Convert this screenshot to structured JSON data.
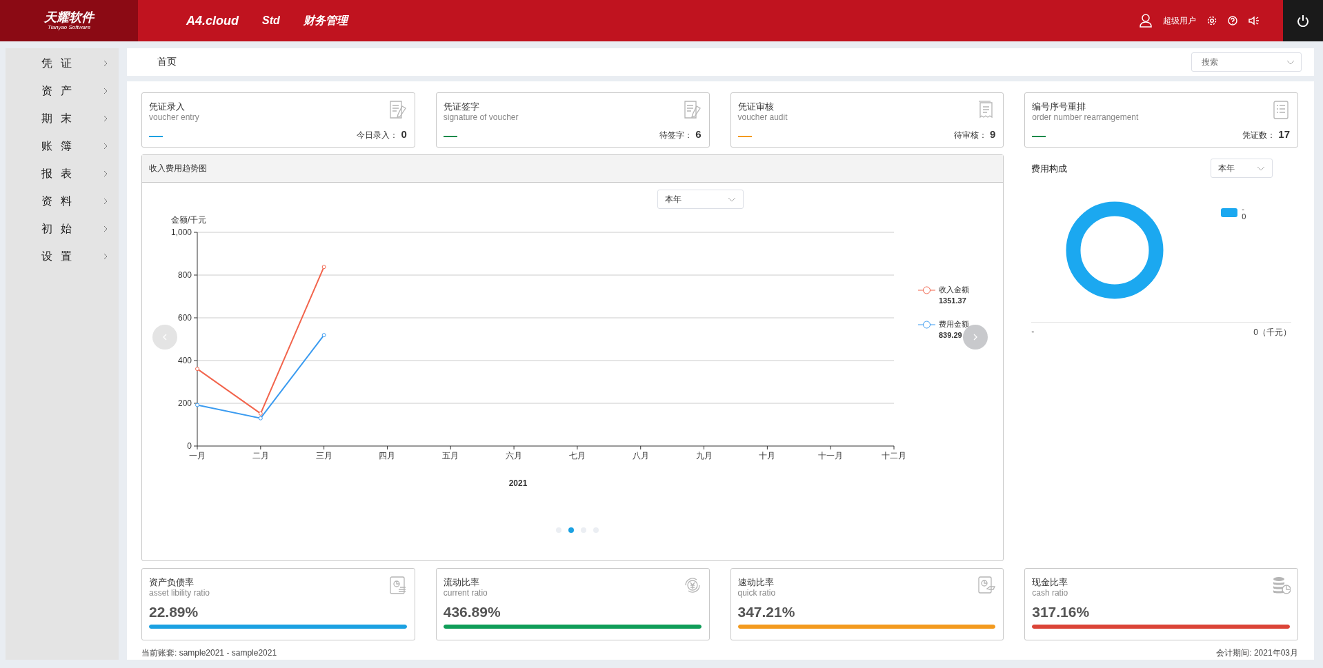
{
  "header": {
    "logo": "天耀软件",
    "logo_sub": "Tianyao Software",
    "nav": [
      "A4.cloud",
      "Std",
      "财务管理"
    ],
    "user": "超级用户"
  },
  "sidebar": {
    "items": [
      {
        "label": "凭证"
      },
      {
        "label": "资产"
      },
      {
        "label": "期末"
      },
      {
        "label": "账簿"
      },
      {
        "label": "报表"
      },
      {
        "label": "资料"
      },
      {
        "label": "初始"
      },
      {
        "label": "设置"
      }
    ]
  },
  "breadcrumb": "首页",
  "search": {
    "placeholder": "搜索"
  },
  "task_cards": [
    {
      "title": "凭证录入",
      "subtitle": "voucher entry",
      "color": "#1ba1e2",
      "count_label": "今日录入：",
      "count": "0",
      "kind": "edit"
    },
    {
      "title": "凭证签字",
      "subtitle": "signature of voucher",
      "color": "#0f8a4a",
      "count_label": "待签字：",
      "count": "6",
      "kind": "edit"
    },
    {
      "title": "凭证审核",
      "subtitle": "voucher audit",
      "color": "#f39a1e",
      "count_label": "待审核：",
      "count": "9",
      "kind": "receipt"
    },
    {
      "title": "编号序号重排",
      "subtitle": "order number rearrangement",
      "color": "#0f8a4a",
      "count_label": "凭证数：",
      "count": "17",
      "kind": "list"
    }
  ],
  "trend": {
    "title": "收入费用趋势图",
    "period": "本年",
    "legend_totals": [
      "1351.37",
      "839.29"
    ],
    "chart_data": {
      "type": "line",
      "grid": true,
      "legend": true,
      "xlabel": "2021",
      "ylabel": "金额/千元",
      "categories": [
        "一月",
        "二月",
        "三月",
        "四月",
        "五月",
        "六月",
        "七月",
        "八月",
        "九月",
        "十月",
        "十一月",
        "十二月"
      ],
      "ylim": [
        0,
        1000
      ],
      "yticks": [
        0,
        200,
        400,
        600,
        800,
        {
          "value": 1000,
          "label": "1,000"
        }
      ],
      "series": [
        {
          "name": "收入金额",
          "color": "#f2644c",
          "marker": "circle",
          "values": [
            361,
            152,
            838,
            null,
            null,
            null,
            null,
            null,
            null,
            null,
            null,
            null
          ]
        },
        {
          "name": "费用金额",
          "color": "#3a9bf0",
          "marker": "circle",
          "values": [
            192,
            130,
            519,
            null,
            null,
            null,
            null,
            null,
            null,
            null,
            null,
            null
          ]
        }
      ]
    },
    "pages": [
      {
        "selected": false
      },
      {
        "selected": true
      },
      {
        "selected": false
      },
      {
        "selected": false
      }
    ]
  },
  "composition": {
    "title": "费用构成",
    "period": "本年",
    "legend": {
      "name": "-",
      "value": "0",
      "color": "#1ba8f0"
    },
    "summary": {
      "label": "-",
      "value": "0（千元）"
    }
  },
  "ratio_cards": [
    {
      "title": "资产负债率",
      "subtitle": "asset libility ratio",
      "value": "22.89%",
      "color": "#1ba1e2",
      "level": 1,
      "kind": "report"
    },
    {
      "title": "流动比率",
      "subtitle": "current ratio",
      "value": "436.89%",
      "color": "#0f9d58",
      "level": 1,
      "kind": "yuan"
    },
    {
      "title": "速动比率",
      "subtitle": "quick ratio",
      "value": "347.21%",
      "color": "#f39a1e",
      "level": 1,
      "kind": "tag"
    },
    {
      "title": "现金比率",
      "subtitle": "cash ratio",
      "value": "317.16%",
      "color": "#db4437",
      "level": 1,
      "kind": "coins"
    }
  ],
  "footer": {
    "account": "当前账套: sample2021 - sample2021",
    "period": "会计期间: 2021年03月"
  }
}
